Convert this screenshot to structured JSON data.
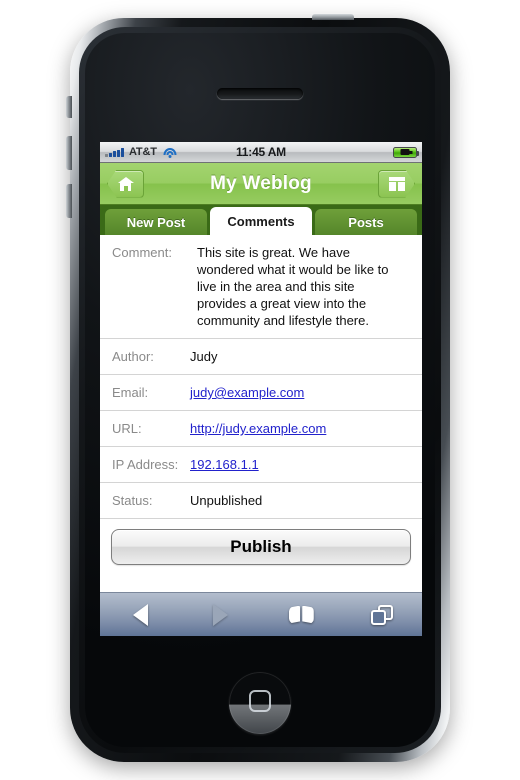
{
  "status_bar": {
    "carrier": "AT&T",
    "time": "11:45 AM",
    "signal_icon": "signal-bars-icon",
    "wifi_icon": "wifi-icon",
    "battery_icon": "battery-charging-icon"
  },
  "header": {
    "title": "My Weblog",
    "left_button_icon": "home-icon",
    "right_button_icon": "dashboard-panels-icon",
    "background_color": "#98cd62"
  },
  "tabs": [
    {
      "label": "New Post",
      "active": false
    },
    {
      "label": "Comments",
      "active": true
    },
    {
      "label": "Posts",
      "active": false
    }
  ],
  "detail_rows": [
    {
      "label": "Comment:",
      "value": "This site is great. We have wondered what it would be like to live in the area and this site provides a great view into the community and lifestyle there.",
      "is_link": false
    },
    {
      "label": "Author:",
      "value": "Judy",
      "is_link": false
    },
    {
      "label": "Email:",
      "value": "judy@example.com",
      "is_link": true
    },
    {
      "label": "URL:",
      "value": "http://judy.example.com",
      "is_link": true
    },
    {
      "label": "IP Address:",
      "value": "192.168.1.1",
      "is_link": true
    },
    {
      "label": "Status:",
      "value": "Unpublished",
      "is_link": false
    }
  ],
  "actions": {
    "publish_label": "Publish"
  },
  "browser_toolbar": {
    "back_icon": "back-arrow-icon",
    "forward_icon": "forward-arrow-icon",
    "bookmarks_icon": "book-icon",
    "pages_icon": "pages-icon",
    "back_enabled": true,
    "forward_enabled": false
  },
  "device": {
    "home_button_icon": "rounded-square-icon",
    "speaker": "earpiece-speaker"
  },
  "colors": {
    "link": "#2222cc",
    "label": "#8a8a8a",
    "tab_strip": "#3a6a17",
    "tab_inactive": "#55862a",
    "toolbar_top": "#b3bdcd",
    "toolbar_bottom": "#5f7496"
  }
}
